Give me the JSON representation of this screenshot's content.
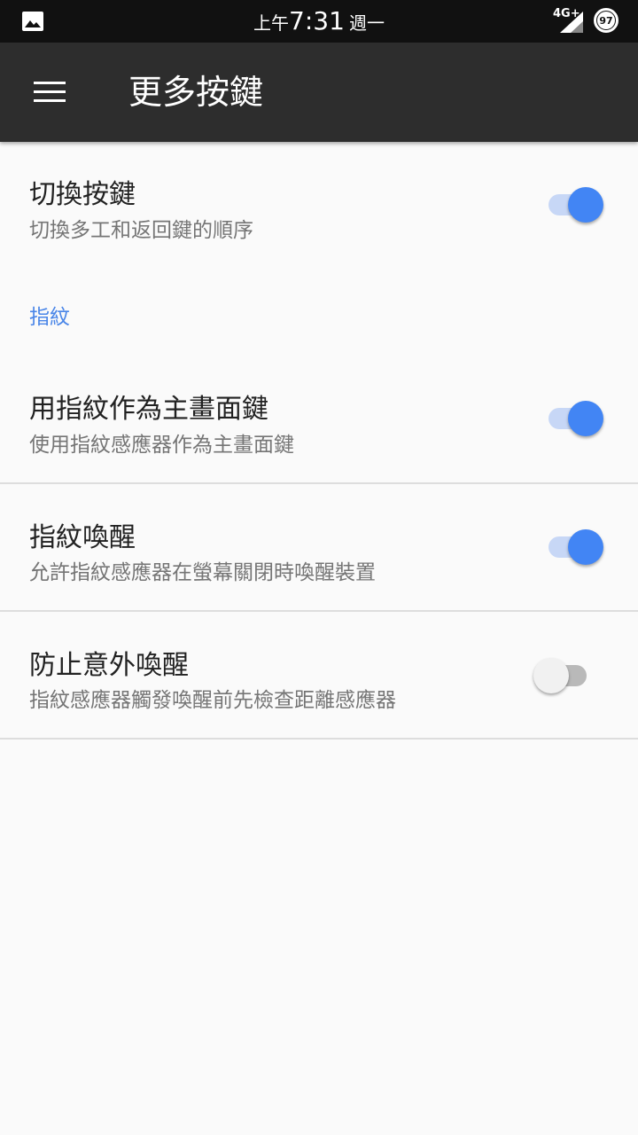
{
  "status_bar": {
    "ampm": "上午",
    "time": "7:31",
    "weekday": "週一",
    "network": "4G+",
    "battery": "97",
    "icons": [
      "image-icon",
      "signal-icon",
      "battery-icon"
    ]
  },
  "app_bar": {
    "menu_icon": "menu-icon",
    "title": "更多按鍵"
  },
  "settings": {
    "swap_keys": {
      "title": "切換按鍵",
      "summary": "切換多工和返回鍵的順序",
      "enabled": true
    },
    "section_fingerprint": "指紋",
    "fp_home": {
      "title": "用指紋作為主畫面鍵",
      "summary": "使用指紋感應器作為主畫面鍵",
      "enabled": true
    },
    "fp_wake": {
      "title": "指紋喚醒",
      "summary": "允許指紋感應器在螢幕關閉時喚醒裝置",
      "enabled": true
    },
    "prevent_wake": {
      "title": "防止意外喚醒",
      "summary": "指紋感應器觸發喚醒前先檢查距離感應器",
      "enabled": false
    }
  },
  "colors": {
    "accent": "#4285f4",
    "app_bar": "#2d2d2d",
    "status_bar": "#111111",
    "background": "#fafafa"
  }
}
